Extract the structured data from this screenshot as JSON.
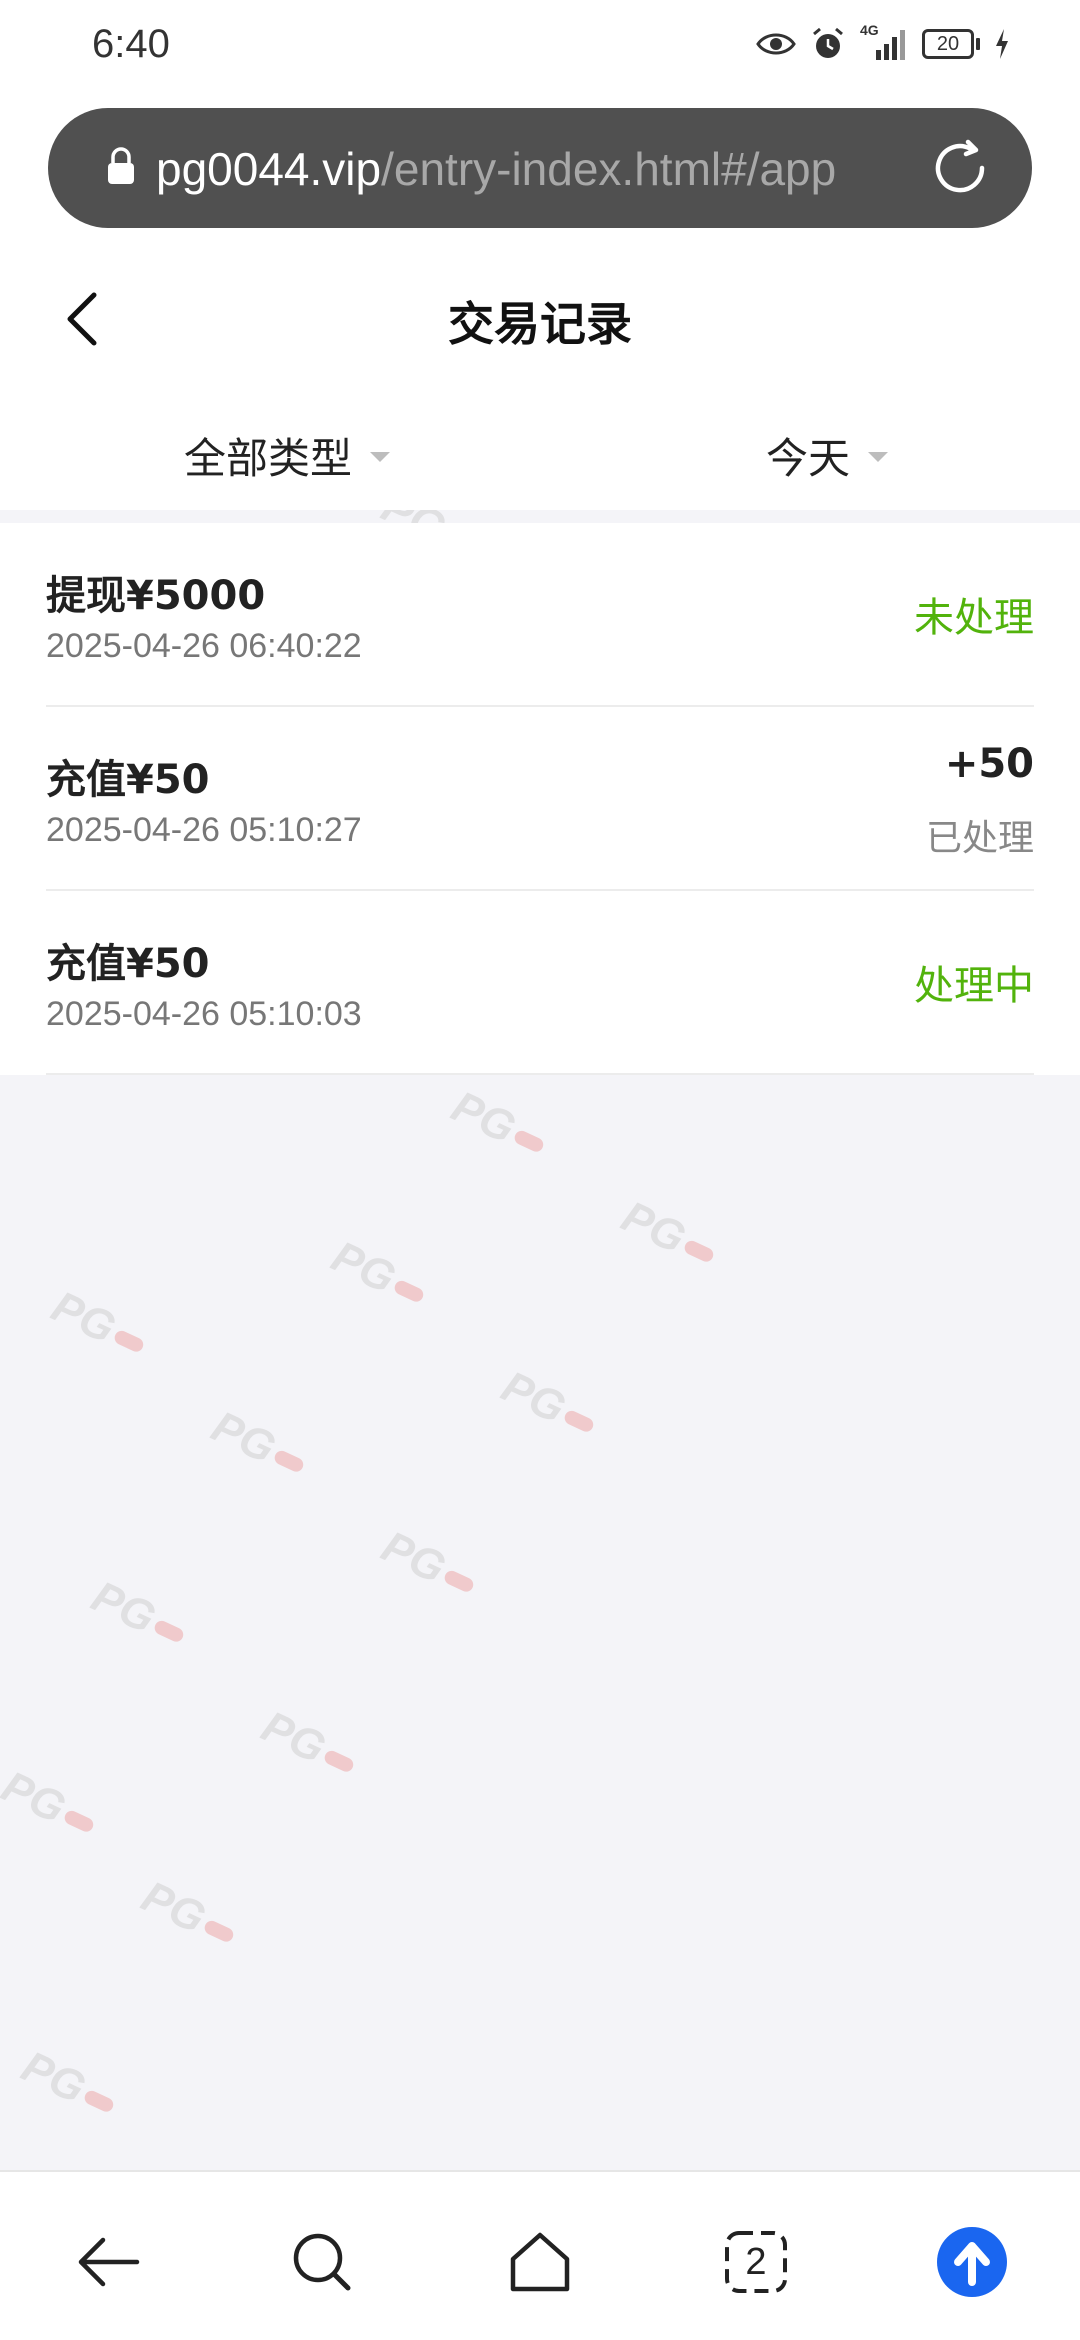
{
  "status_bar": {
    "time": "6:40",
    "network": "4G",
    "battery": "20"
  },
  "url_bar": {
    "domain": "pg0044.vip",
    "path": "/entry-index.html#/app"
  },
  "header": {
    "title": "交易记录"
  },
  "filters": {
    "type_label": "全部类型",
    "date_label": "今天"
  },
  "transactions": [
    {
      "title": "提现¥5000",
      "time": "2025-04-26 06:40:22",
      "status": "未处理"
    },
    {
      "title": "充值¥50",
      "time": "2025-04-26 05:10:27",
      "amount": "+50",
      "status": "已处理"
    },
    {
      "title": "充值¥50",
      "time": "2025-04-26 05:10:03",
      "status": "处理中"
    }
  ],
  "bottom_nav": {
    "tab_count": "2"
  },
  "watermark": "PG",
  "colors": {
    "status_green": "#52b30c",
    "status_gray": "#888888",
    "accent_blue": "#1a66f0",
    "url_bar_bg": "#505050",
    "page_bg": "#f4f4f8"
  }
}
